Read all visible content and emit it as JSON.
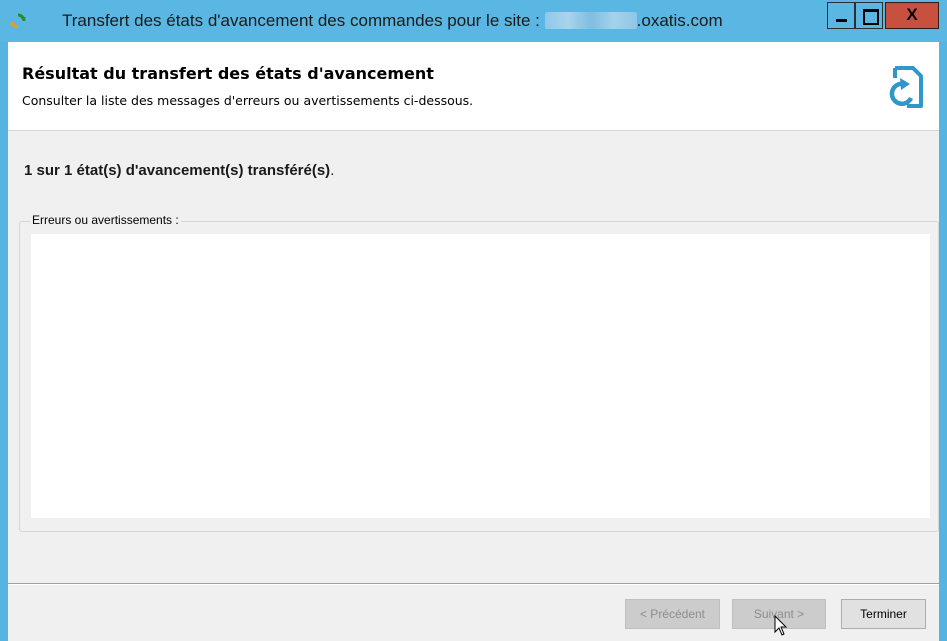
{
  "window": {
    "title_prefix": "Transfert des états d'avancement des commandes pour le site : ",
    "title_suffix": ".oxatis.com",
    "close_label": "X"
  },
  "header": {
    "title": "Résultat du transfert des états d'avancement",
    "subtitle": "Consulter la liste des messages d'erreurs ou avertissements ci-dessous."
  },
  "main": {
    "result_text": "1 sur 1 état(s) d'avancement(s) transféré(s)",
    "result_period": ".",
    "messages_label": "Erreurs ou avertissements :",
    "messages_content": ""
  },
  "footer": {
    "previous_label": "< Précédent",
    "next_label": "Suivant >",
    "finish_label": "Terminer"
  },
  "colors": {
    "titlebar": "#5ab7e3",
    "close_button": "#c7503f",
    "header_icon": "#2f97c9"
  },
  "icons": {
    "app": "refresh-icon",
    "header": "document-refresh-icon"
  }
}
